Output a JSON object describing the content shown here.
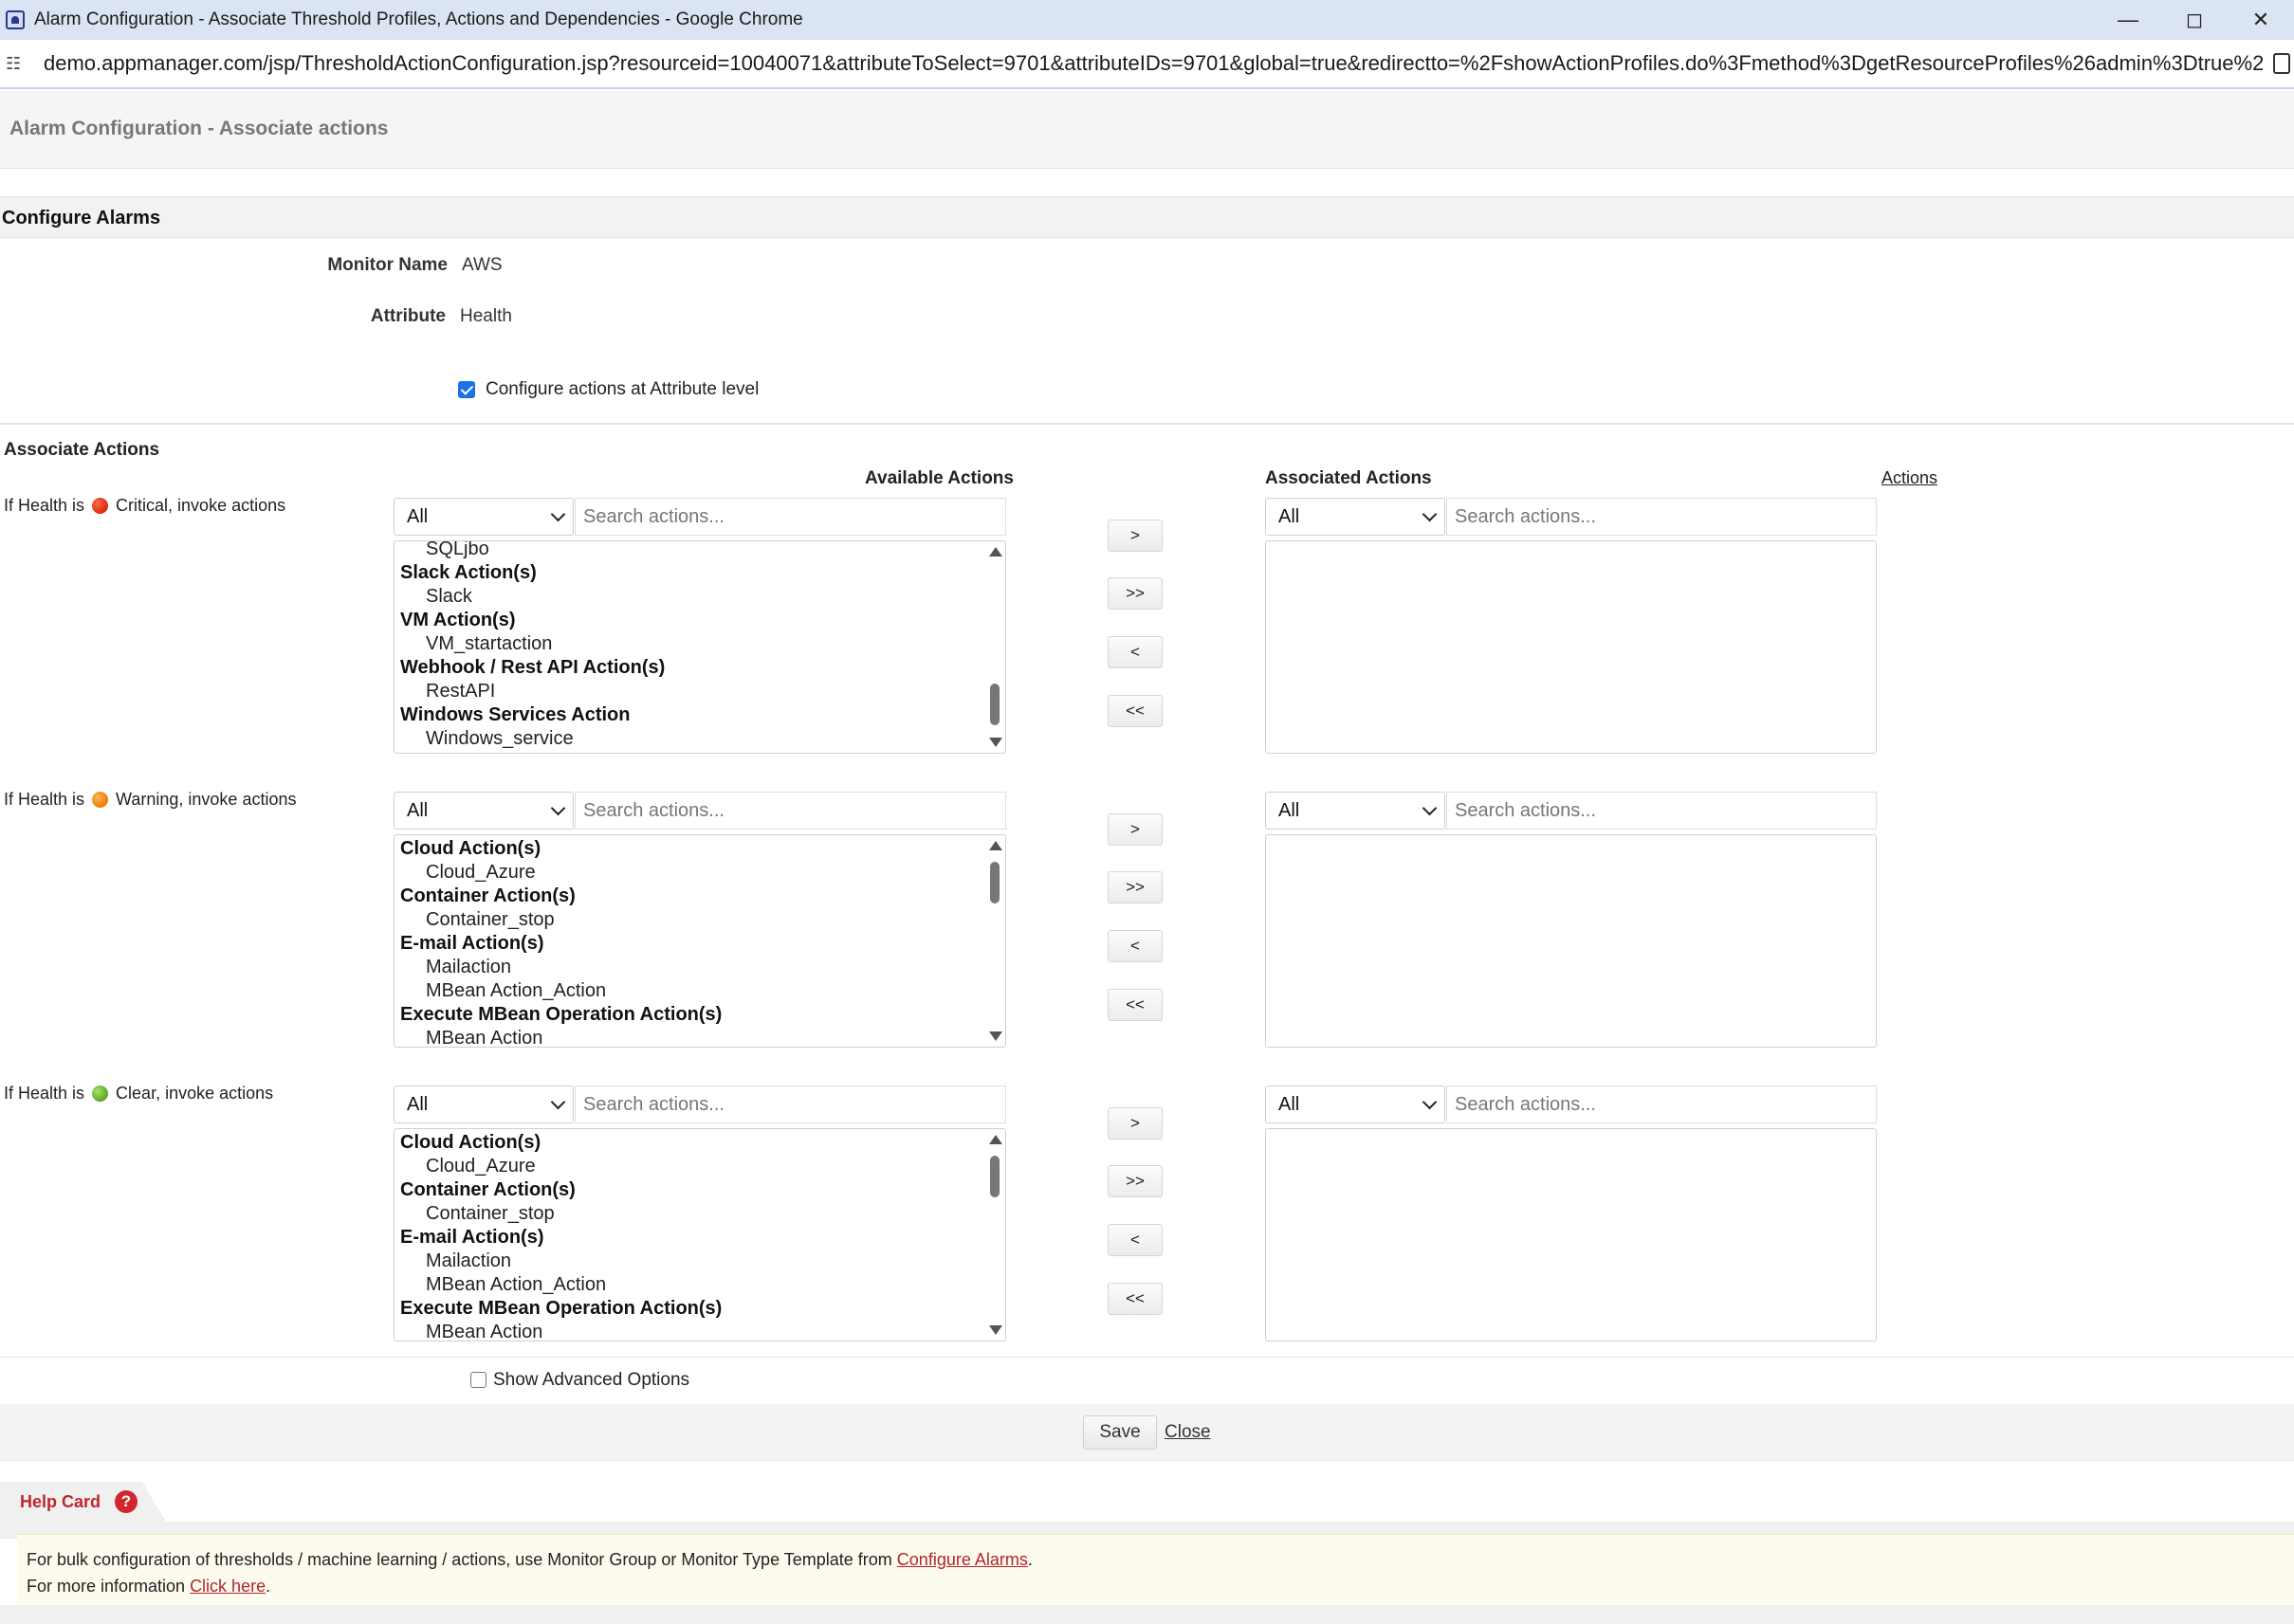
{
  "window": {
    "title": "Alarm Configuration - Associate Threshold Profiles, Actions and Dependencies - Google Chrome",
    "url": "demo.appmanager.com/jsp/ThresholdActionConfiguration.jsp?resourceid=10040071&attributeToSelect=9701&attributeIDs=9701&global=true&redirectto=%2FshowActionProfiles.do%3Fmethod%3DgetResourceProfiles%26admin%3Dtrue%26monitor..."
  },
  "header": {
    "title": "Alarm Configuration - Associate actions"
  },
  "configure": {
    "title": "Configure Alarms",
    "monitor_label": "Monitor Name",
    "monitor_value": "AWS",
    "attribute_label": "Attribute",
    "attribute_value": "Health",
    "attr_level_label": "Configure actions at Attribute level",
    "attr_level_checked": true
  },
  "associate": {
    "title": "Associate Actions",
    "available_header": "Available Actions",
    "associated_header": "Associated Actions",
    "actions_link": "Actions",
    "filter_value": "All",
    "search_placeholder": "Search actions...",
    "buttons": {
      "add": ">",
      "add_all": ">>",
      "remove": "<",
      "remove_all": "<<"
    },
    "rows": [
      {
        "prefix": "If Health is",
        "severity": "Critical, invoke actions",
        "dot_color": "#e0330f",
        "available": [
          {
            "type": "item",
            "label": "SQLjbo"
          },
          {
            "type": "group",
            "label": "Slack Action(s)"
          },
          {
            "type": "item",
            "label": "Slack"
          },
          {
            "type": "group",
            "label": "VM Action(s)"
          },
          {
            "type": "item",
            "label": "VM_startaction"
          },
          {
            "type": "group",
            "label": "Webhook / Rest API Action(s)"
          },
          {
            "type": "item",
            "label": "RestAPI"
          },
          {
            "type": "group",
            "label": "Windows Services Action"
          },
          {
            "type": "item",
            "label": "Windows_service"
          }
        ]
      },
      {
        "prefix": "If Health is",
        "severity": "Warning, invoke actions",
        "dot_color": "#f28a0c",
        "available": [
          {
            "type": "group",
            "label": "Cloud Action(s)"
          },
          {
            "type": "item",
            "label": "Cloud_Azure"
          },
          {
            "type": "group",
            "label": "Container Action(s)"
          },
          {
            "type": "item",
            "label": "Container_stop"
          },
          {
            "type": "group",
            "label": "E-mail Action(s)"
          },
          {
            "type": "item",
            "label": "Mailaction"
          },
          {
            "type": "item",
            "label": "MBean Action_Action"
          },
          {
            "type": "group",
            "label": "Execute MBean Operation Action(s)"
          },
          {
            "type": "item",
            "label": "MBean Action"
          }
        ]
      },
      {
        "prefix": "If Health is",
        "severity": "Clear, invoke actions",
        "dot_color": "#6ab52e",
        "available": [
          {
            "type": "group",
            "label": "Cloud Action(s)"
          },
          {
            "type": "item",
            "label": "Cloud_Azure"
          },
          {
            "type": "group",
            "label": "Container Action(s)"
          },
          {
            "type": "item",
            "label": "Container_stop"
          },
          {
            "type": "group",
            "label": "E-mail Action(s)"
          },
          {
            "type": "item",
            "label": "Mailaction"
          },
          {
            "type": "item",
            "label": "MBean Action_Action"
          },
          {
            "type": "group",
            "label": "Execute MBean Operation Action(s)"
          },
          {
            "type": "item",
            "label": "MBean Action"
          }
        ]
      }
    ]
  },
  "advanced": {
    "label": "Show Advanced Options",
    "checked": false
  },
  "footer": {
    "save_label": "Save",
    "close_label": "Close"
  },
  "help": {
    "title": "Help Card",
    "line1_text": "For bulk configuration of thresholds / machine learning / actions, use Monitor Group or Monitor Type Template from ",
    "line1_link": "Configure Alarms",
    "line1_end": ".",
    "line2_text": "For more information ",
    "line2_link": "Click here",
    "line2_end": "."
  }
}
